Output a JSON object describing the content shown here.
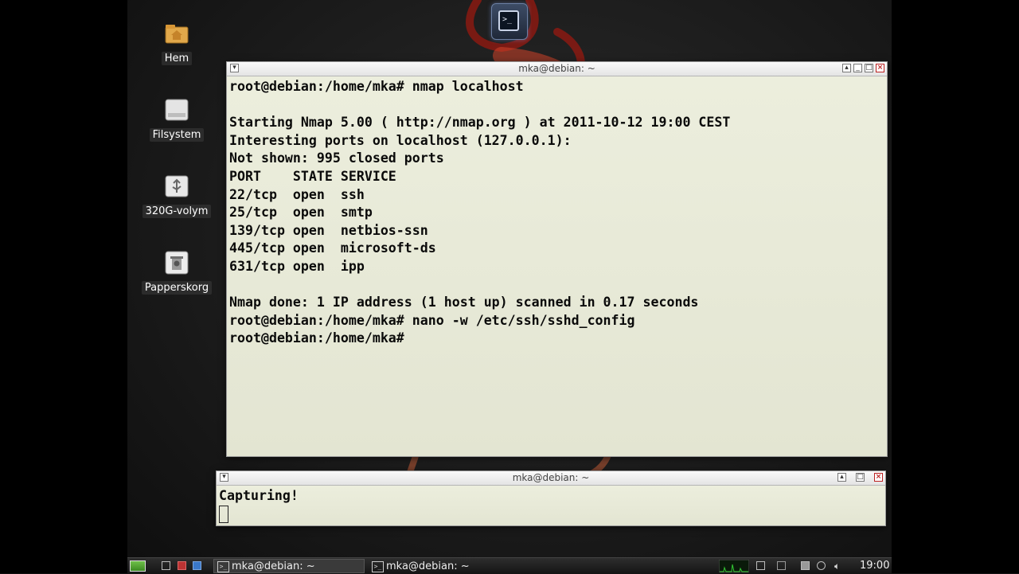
{
  "desktop": {
    "icons": [
      {
        "label": "Hem",
        "icon": "home-folder-icon"
      },
      {
        "label": "Filsystem",
        "icon": "drive-icon"
      },
      {
        "label": "320G-volym",
        "icon": "usb-volume-icon"
      },
      {
        "label": "Papperskorg",
        "icon": "trash-icon"
      }
    ]
  },
  "launcher": {
    "icon": "terminal-icon",
    "glyph": ">_"
  },
  "main_terminal": {
    "title": "mka@debian: ~",
    "lines": [
      "root@debian:/home/mka# nmap localhost",
      "",
      "Starting Nmap 5.00 ( http://nmap.org ) at 2011-10-12 19:00 CEST",
      "Interesting ports on localhost (127.0.0.1):",
      "Not shown: 995 closed ports",
      "PORT    STATE SERVICE",
      "22/tcp  open  ssh",
      "25/tcp  open  smtp",
      "139/tcp open  netbios-ssn",
      "445/tcp open  microsoft-ds",
      "631/tcp open  ipp",
      "",
      "Nmap done: 1 IP address (1 host up) scanned in 0.17 seconds",
      "root@debian:/home/mka# nano -w /etc/ssh/sshd_config",
      "root@debian:/home/mka# "
    ]
  },
  "second_terminal": {
    "title": "mka@debian: ~",
    "lines": [
      "Capturing!"
    ]
  },
  "taskbar": {
    "tasks": [
      {
        "label": "mka@debian: ~",
        "icon": "terminal-icon"
      },
      {
        "label": "mka@debian: ~",
        "icon": "terminal-icon"
      }
    ],
    "clock": "19:00"
  },
  "colors": {
    "terminal_bg": "#e6e8d6",
    "dragon": "#c9502a",
    "taskbar_bg": "#1e1e1e"
  }
}
